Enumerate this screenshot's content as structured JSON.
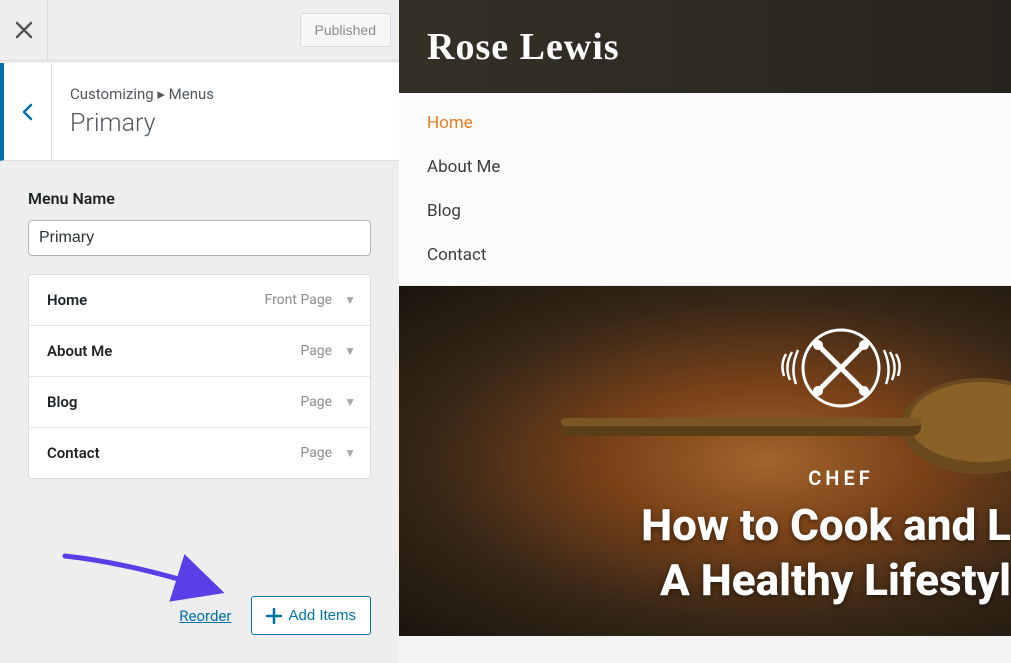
{
  "sidebar": {
    "publish_label": "Published",
    "breadcrumb_prefix": "Customizing",
    "breadcrumb_current": "Menus",
    "section_title": "Primary",
    "menu_name_label": "Menu Name",
    "menu_name_value": "Primary",
    "reorder_label": "Reorder",
    "add_items_label": "Add Items",
    "menu_items": [
      {
        "title": "Home",
        "type": "Front Page"
      },
      {
        "title": "About Me",
        "type": "Page"
      },
      {
        "title": "Blog",
        "type": "Page"
      },
      {
        "title": "Contact",
        "type": "Page"
      }
    ]
  },
  "preview": {
    "site_title": "Rose Lewis",
    "nav": [
      {
        "label": "Home",
        "active": true
      },
      {
        "label": "About Me",
        "active": false
      },
      {
        "label": "Blog",
        "active": false
      },
      {
        "label": "Contact",
        "active": false
      }
    ],
    "badge_text": "CHEF",
    "headline_line1": "How to Cook and L",
    "headline_line2": "A Healthy Lifestyl"
  }
}
